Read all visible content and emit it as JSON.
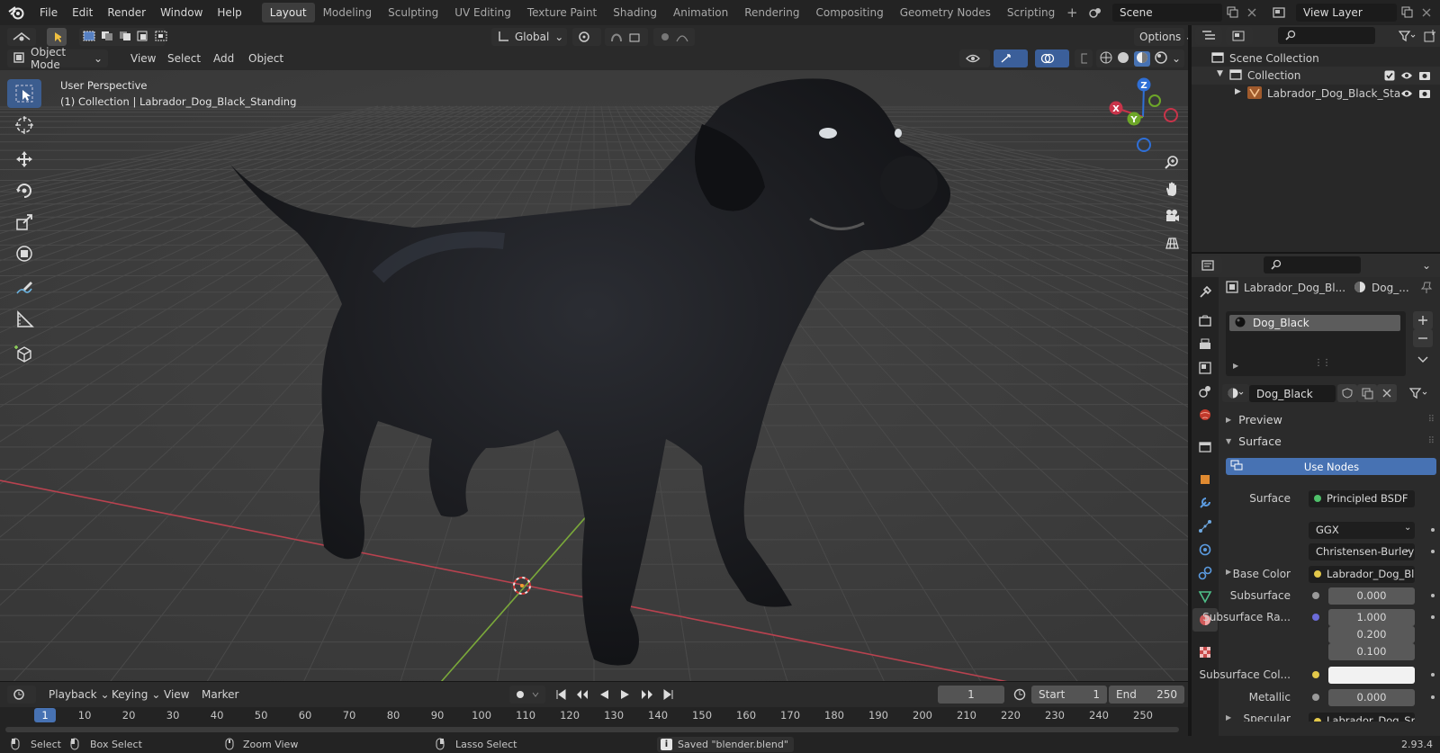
{
  "menubar": {
    "items": [
      "File",
      "Edit",
      "Render",
      "Window",
      "Help"
    ]
  },
  "workspaces": {
    "tabs": [
      "Layout",
      "Modeling",
      "Sculpting",
      "UV Editing",
      "Texture Paint",
      "Shading",
      "Animation",
      "Rendering",
      "Compositing",
      "Geometry Nodes",
      "Scripting"
    ],
    "active": "Layout",
    "add_label": "+"
  },
  "scene": {
    "name": "Scene",
    "view_layer": "View Layer"
  },
  "viewport_header": {
    "transform": "Global",
    "options": "Options",
    "mode": "Object Mode",
    "menus": [
      "View",
      "Select",
      "Add",
      "Object"
    ]
  },
  "viewport": {
    "perspective": "User Perspective",
    "collection_info": "(1) Collection | Labrador_Dog_Black_Standing",
    "axis_x": "X",
    "axis_y": "Y",
    "axis_z": "Z"
  },
  "outliner": {
    "root": "Scene Collection",
    "collection": "Collection",
    "object": "Labrador_Dog_Black_Sta"
  },
  "properties": {
    "object_name": "Labrador_Dog_Bl...",
    "material_short": "Dog_...",
    "slot_name": "Dog_Black",
    "material_name": "Dog_Black",
    "preview_label": "Preview",
    "surface_label": "Surface",
    "use_nodes": "Use Nodes",
    "surface_shader_label": "Surface",
    "surface_shader": "Principled BSDF",
    "distribution": "GGX",
    "subsurface_method": "Christensen-Burley",
    "rows": [
      {
        "label": "Base Color",
        "value": "Labrador_Dog_Bla..."
      },
      {
        "label": "Subsurface",
        "value": "0.000"
      },
      {
        "label": "Subsurface Ra...",
        "value": "1.000"
      },
      {
        "label": "",
        "value": "0.200"
      },
      {
        "label": "",
        "value": "0.100"
      },
      {
        "label": "Subsurface Col...",
        "value": ""
      },
      {
        "label": "Metallic",
        "value": "0.000"
      },
      {
        "label": "Specular",
        "value": "Labrador_Dog_Spe..."
      }
    ]
  },
  "timeline": {
    "menus": [
      "Playback",
      "Keying",
      "View",
      "Marker"
    ],
    "current_frame": "1",
    "start_label": "Start",
    "start": "1",
    "end_label": "End",
    "end": "250",
    "ruler": [
      "1",
      "10",
      "20",
      "30",
      "40",
      "50",
      "60",
      "70",
      "80",
      "90",
      "100",
      "110",
      "120",
      "130",
      "140",
      "150",
      "160",
      "170",
      "180",
      "190",
      "200",
      "210",
      "220",
      "230",
      "240",
      "250"
    ]
  },
  "statusbar": {
    "select": "Select",
    "box_select": "Box Select",
    "zoom_view": "Zoom View",
    "lasso_select": "Lasso Select",
    "message": "Saved \"blender.blend\"",
    "version": "2.93.4"
  },
  "colors": {
    "accent": "#4772b3",
    "x_axis": "#c8344a",
    "y_axis": "#6da628",
    "z_axis": "#2f6fd6"
  }
}
